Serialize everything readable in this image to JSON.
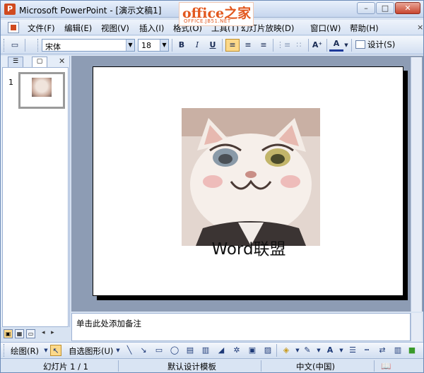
{
  "window": {
    "title": "Microsoft PowerPoint - [演示文稿1]",
    "min_glyph": "–",
    "max_glyph": "□",
    "close_glyph": "✕"
  },
  "logo": {
    "main": "office之家",
    "sub": "OFFICE.JB51.NET"
  },
  "menu": {
    "items": [
      "文件(F)",
      "编辑(E)",
      "视图(V)",
      "插入(I)",
      "格式(O)",
      "工具(T)",
      "幻灯片放映(D)",
      "窗口(W)",
      "帮助(H)"
    ],
    "close_glyph": "×"
  },
  "toolbar": {
    "font": "宋体",
    "size": "18",
    "bold": "B",
    "italic": "I",
    "underline": "U",
    "grow_font": "A⁺",
    "font_color": "A",
    "design_label": "设计(S)"
  },
  "left_pane": {
    "tabs": [
      "☰",
      "▢"
    ],
    "close_glyph": "✕",
    "slide_number": "1"
  },
  "slide": {
    "caption": "Word联盟"
  },
  "notes": {
    "placeholder": "单击此处添加备注"
  },
  "draw_toolbar": {
    "draw_label": "绘图(R)",
    "autoshape_label": "自选图形(U)"
  },
  "status": {
    "slide_info": "幻灯片 1 / 1",
    "template": "默认设计模板",
    "language": "中文(中国)"
  },
  "colors": {
    "accent": "#d04a1f",
    "logo": "#e2581f",
    "slide_bg": "#8d9cb4",
    "selected": "#fcd98a"
  }
}
